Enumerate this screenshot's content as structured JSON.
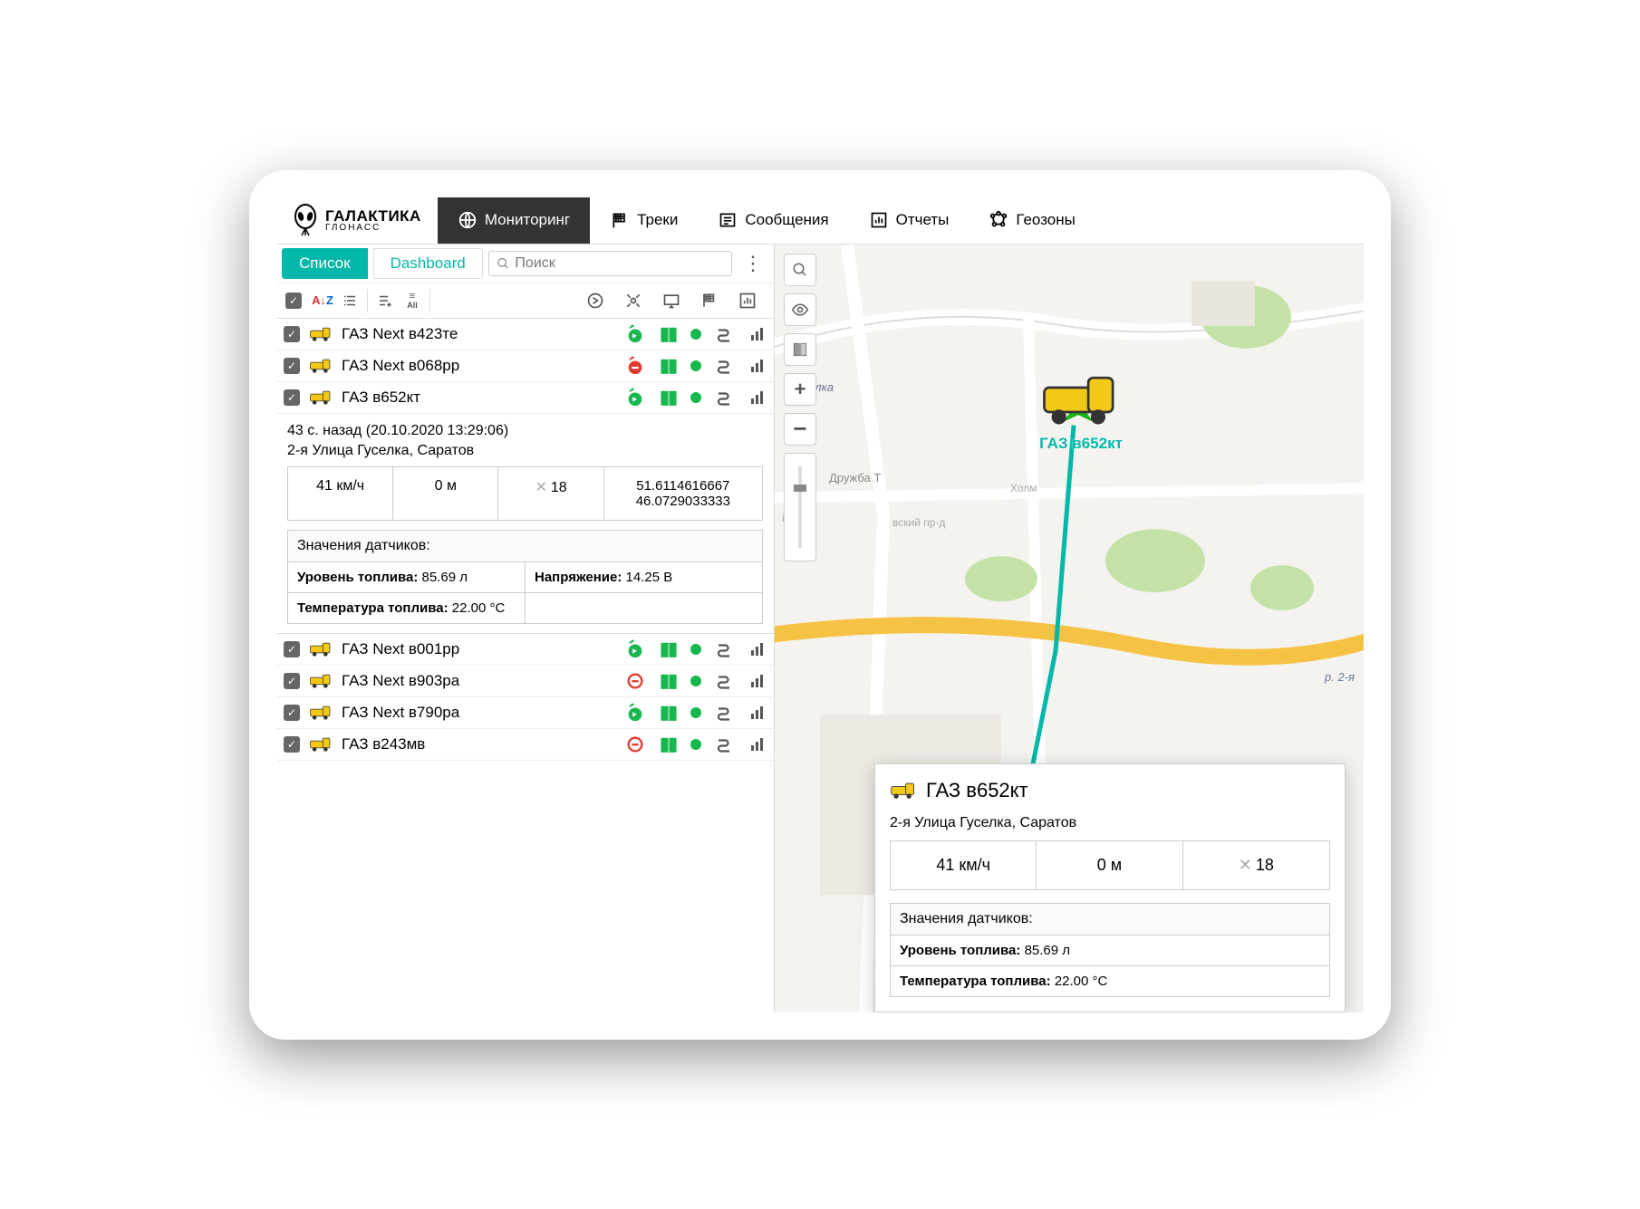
{
  "brand": {
    "line1": "ГАЛАКТИКА",
    "line2": "ГЛОНАСС"
  },
  "nav": {
    "monitoring": "Мониторинг",
    "tracks": "Треки",
    "messages": "Сообщения",
    "reports": "Отчеты",
    "geozones": "Геозоны"
  },
  "tabs": {
    "list": "Список",
    "dashboard": "Dashboard"
  },
  "search": {
    "placeholder": "Поиск"
  },
  "vehicles": [
    {
      "name": "ГАЗ Next в423те",
      "status": "go-green"
    },
    {
      "name": "ГАЗ Next в068рр",
      "status": "stop-red-filled"
    },
    {
      "name": "ГАЗ в652кт",
      "status": "go-green",
      "expanded": true
    },
    {
      "name": "ГАЗ Next в001рр",
      "status": "go-green"
    },
    {
      "name": "ГАЗ Next в903ра",
      "status": "stop-red-outline"
    },
    {
      "name": "ГАЗ Next в790ра",
      "status": "go-green"
    },
    {
      "name": "ГАЗ в243мв",
      "status": "stop-red-outline"
    }
  ],
  "detail": {
    "timestamp": "43 с. назад (20.10.2020 13:29:06)",
    "address": "2-я Улица Гуселка, Саратов",
    "speed": "41 км/ч",
    "altitude": "0 м",
    "sat": "18",
    "lat": "51.6114616667",
    "lon": "46.0729033333",
    "sensors_header": "Значения датчиков:",
    "fuel_label": "Уровень топлива:",
    "fuel_value": "85.69 л",
    "volt_label": "Напряжение:",
    "volt_value": "14.25 В",
    "ftemp_label": "Температура топлива:",
    "ftemp_value": "22.00 °C"
  },
  "map": {
    "vehicle_label": "ГАЗ в652кт",
    "labels": {
      "guselka": "Гуселка",
      "druzhba": "Дружба Т",
      "kholm": "Холм",
      "prd": "вский пр-д",
      "river": "р. 2-я",
      "gu": "й Гу"
    }
  },
  "popup": {
    "title": "ГАЗ в652кт",
    "address": "2-я Улица Гуселка, Саратов",
    "speed": "41 км/ч",
    "altitude": "0 м",
    "sat": "18",
    "sensors_header": "Значения датчиков:",
    "fuel_label": "Уровень топлива:",
    "fuel_value": "85.69 л",
    "ftemp_label": "Температура топлива:",
    "ftemp_value": "22.00 °C"
  }
}
